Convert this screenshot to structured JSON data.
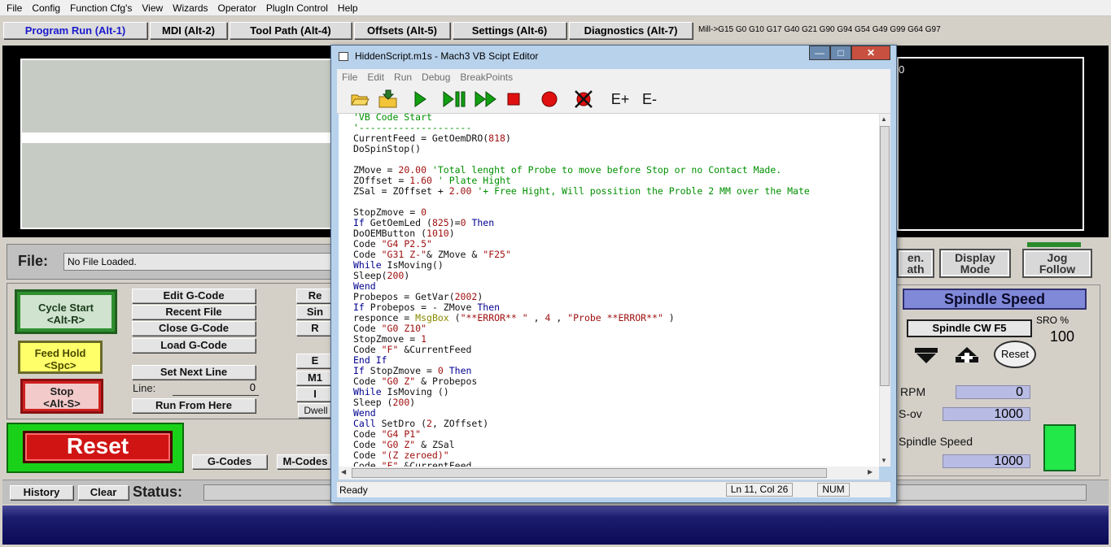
{
  "menu": [
    "File",
    "Config",
    "Function Cfg's",
    "View",
    "Wizards",
    "Operator",
    "PlugIn Control",
    "Help"
  ],
  "tabs": [
    "Program Run (Alt-1)",
    "MDI (Alt-2)",
    "Tool Path (Alt-4)",
    "Offsets (Alt-5)",
    "Settings (Alt-6)",
    "Diagnostics (Alt-7)"
  ],
  "modal_line": "Mill->G15  G0 G10 G17 G40 G21 G90 G94 G54 G49 G99 G64 G97",
  "toolpath": {
    "zero_readout": "0"
  },
  "file": {
    "label": "File:",
    "value": "No File Loaded."
  },
  "controls": {
    "cycle_start": [
      "Cycle Start",
      "<Alt-R>"
    ],
    "feed_hold": [
      "Feed Hold",
      "<Spc>"
    ],
    "stop": [
      "Stop",
      "<Alt-S>"
    ],
    "edit_gcode": "Edit G-Code",
    "recent_file": "Recent File",
    "close_gcode": "Close G-Code",
    "load_gcode": "Load G-Code",
    "set_next_line": "Set Next Line",
    "line_label": "Line:",
    "line_value": "0",
    "run_from_here": "Run From Here",
    "partial_labels": [
      "Re",
      "Sin",
      "R",
      "E",
      "M1",
      "I",
      "Dwell"
    ]
  },
  "reset": {
    "label": "Reset",
    "gcodes": "G-Codes",
    "mcodes": "M-Codes"
  },
  "status": {
    "history": "History",
    "clear": "Clear",
    "label": "Status:"
  },
  "right_panel": {
    "regen": [
      "en.",
      "ath"
    ],
    "display_mode": [
      "Display",
      "Mode"
    ],
    "jog_follow": [
      "Jog",
      "Follow"
    ],
    "spindle_title": "Spindle Speed",
    "spindle_cw": "Spindle CW F5",
    "sro_label": "SRO %",
    "sro_value": "100",
    "reset": "Reset",
    "rpm_label": "RPM",
    "rpm_value": "0",
    "sov_label": "S-ov",
    "sov_value": "1000",
    "speed_label": "Spindle Speed",
    "speed_value": "1000"
  },
  "editor": {
    "title": "HiddenScript.m1s - Mach3 VB Scipt Editor",
    "menu": [
      "File",
      "Edit",
      "Run",
      "Debug",
      "BreakPoints"
    ],
    "toolbar_icons": [
      "open-folder-icon",
      "save-icon",
      "run-icon",
      "step-pause-icon",
      "step-icon",
      "stop-icon",
      "breakpoint-icon",
      "clear-breakpoints-icon",
      "expand-icon",
      "collapse-icon"
    ],
    "toolbar_text": [
      "E+",
      "E-"
    ],
    "status_ready": "Ready",
    "status_pos": "Ln 11, Col 26",
    "status_num": "NUM",
    "code": [
      [
        [
          "c",
          "'VB Code Start"
        ]
      ],
      [
        [
          "c",
          "'--------------------"
        ]
      ],
      [
        [
          "n",
          "CurrentFeed = GetOemDRO("
        ],
        [
          "num",
          "818"
        ],
        [
          "n",
          ")"
        ]
      ],
      [
        [
          "n",
          "DoSpinStop()"
        ]
      ],
      [],
      [
        [
          "n",
          "ZMove = "
        ],
        [
          "num",
          "20.00"
        ],
        [
          "c",
          " 'Total lenght of Probe to move before Stop or no Contact Made."
        ]
      ],
      [
        [
          "n",
          "ZOffset = "
        ],
        [
          "num",
          "1.60"
        ],
        [
          "c",
          " ' Plate Hight"
        ]
      ],
      [
        [
          "n",
          "ZSal = ZOffset + "
        ],
        [
          "num",
          "2.00"
        ],
        [
          "c",
          " '+ Free Hight, Will possition the Proble 2 MM over the Mate"
        ]
      ],
      [],
      [
        [
          "n",
          "StopZmove = "
        ],
        [
          "num",
          "0"
        ]
      ],
      [
        [
          "k",
          "If"
        ],
        [
          "n",
          " GetOemLed ("
        ],
        [
          "num",
          "825"
        ],
        [
          "n",
          ")="
        ],
        [
          "num",
          "0"
        ],
        [
          "k",
          " Then"
        ]
      ],
      [
        [
          "n",
          "DoOEMButton ("
        ],
        [
          "num",
          "1010"
        ],
        [
          "n",
          ")"
        ]
      ],
      [
        [
          "n",
          "Code "
        ],
        [
          "s",
          "\"G4 P2.5\""
        ]
      ],
      [
        [
          "n",
          "Code "
        ],
        [
          "s",
          "\"G31 Z-\""
        ],
        [
          "n",
          "& ZMove & "
        ],
        [
          "s",
          "\"F25\""
        ]
      ],
      [
        [
          "k",
          "While"
        ],
        [
          "n",
          " IsMoving()"
        ]
      ],
      [
        [
          "n",
          "Sleep("
        ],
        [
          "num",
          "200"
        ],
        [
          "n",
          ")"
        ]
      ],
      [
        [
          "k",
          "Wend"
        ]
      ],
      [
        [
          "n",
          "Probepos = GetVar("
        ],
        [
          "num",
          "2002"
        ],
        [
          "n",
          ")"
        ]
      ],
      [
        [
          "k",
          "If"
        ],
        [
          "n",
          " Probepos = - ZMove "
        ],
        [
          "k",
          "Then"
        ]
      ],
      [
        [
          "n",
          "responce = "
        ],
        [
          "f",
          "MsgBox"
        ],
        [
          "n",
          " ("
        ],
        [
          "s",
          "\"**ERROR** \""
        ],
        [
          "n",
          " , "
        ],
        [
          "num",
          "4"
        ],
        [
          "n",
          " , "
        ],
        [
          "s",
          "\"Probe **ERROR**\""
        ],
        [
          "n",
          " )"
        ]
      ],
      [
        [
          "n",
          "Code "
        ],
        [
          "s",
          "\"G0 Z10\""
        ]
      ],
      [
        [
          "n",
          "StopZmove = "
        ],
        [
          "num",
          "1"
        ]
      ],
      [
        [
          "n",
          "Code "
        ],
        [
          "s",
          "\"F\""
        ],
        [
          "n",
          " &CurrentFeed"
        ]
      ],
      [
        [
          "k",
          "End If"
        ]
      ],
      [
        [
          "k",
          "If"
        ],
        [
          "n",
          " StopZmove = "
        ],
        [
          "num",
          "0"
        ],
        [
          "k",
          " Then"
        ]
      ],
      [
        [
          "n",
          "Code "
        ],
        [
          "s",
          "\"G0 Z\""
        ],
        [
          "n",
          " & Probepos"
        ]
      ],
      [
        [
          "k",
          "While"
        ],
        [
          "n",
          " IsMoving ()"
        ]
      ],
      [
        [
          "n",
          "Sleep ("
        ],
        [
          "num",
          "200"
        ],
        [
          "n",
          ")"
        ]
      ],
      [
        [
          "k",
          "Wend"
        ]
      ],
      [
        [
          "k",
          "Call"
        ],
        [
          "n",
          " SetDro ("
        ],
        [
          "num",
          "2"
        ],
        [
          "n",
          ", ZOffset)"
        ]
      ],
      [
        [
          "n",
          "Code "
        ],
        [
          "s",
          "\"G4 P1\""
        ]
      ],
      [
        [
          "n",
          "Code "
        ],
        [
          "s",
          "\"G0 Z\""
        ],
        [
          "n",
          " & ZSal"
        ]
      ],
      [
        [
          "n",
          "Code "
        ],
        [
          "s",
          "\"(Z zeroed)\""
        ]
      ],
      [
        [
          "n",
          "Code "
        ],
        [
          "s",
          "\"F\""
        ],
        [
          "n",
          " &CurrentFeed"
        ]
      ]
    ]
  },
  "colors": {
    "active_tab": "#1a1acc",
    "comment": "#009000",
    "keyword": "#000090",
    "string": "#a01010",
    "reset_red": "#d01414",
    "spindle_led": "#22e84a"
  }
}
